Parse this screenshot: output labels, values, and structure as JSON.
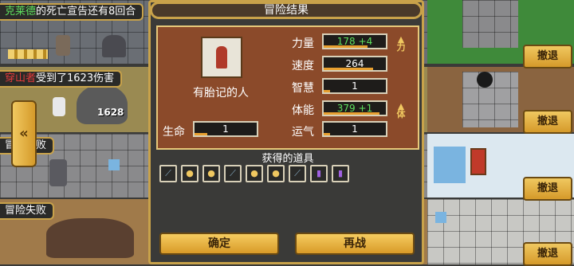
{
  "lanes": [
    {
      "strip_name": "克莱德",
      "strip_text": "的死亡宣告还有8回合",
      "retreat": "撤退"
    },
    {
      "strip_name": "穿山者",
      "strip_text": "受到了1623伤害",
      "damage": "1628",
      "retreat": "撤退"
    },
    {
      "strip_text": "冒险失败",
      "retreat": "撤退"
    },
    {
      "strip_text": "冒险失败",
      "retreat": "撤退"
    }
  ],
  "modal": {
    "title": "冒险结果",
    "character_name": "有胎记的人",
    "hp_label": "生命",
    "hp_value": "1",
    "stats": [
      {
        "label": "力量",
        "value": "178",
        "bonus": "+4",
        "highlight": true,
        "arrow": true,
        "arrow_label": "力"
      },
      {
        "label": "速度",
        "value": "264",
        "bonus": "",
        "highlight": false,
        "arrow": false
      },
      {
        "label": "智慧",
        "value": "1",
        "bonus": "",
        "highlight": false,
        "arrow": false
      },
      {
        "label": "体能",
        "value": "379",
        "bonus": "+1",
        "highlight": true,
        "arrow": true,
        "arrow_label": "体"
      },
      {
        "label": "运气",
        "value": "1",
        "bonus": "",
        "highlight": false,
        "arrow": false
      }
    ],
    "items_title": "获得的道具",
    "items": [
      "sword-icon",
      "gold-icon",
      "gold-icon",
      "sword-icon",
      "gold-icon",
      "gold-icon",
      "sword-icon",
      "potion-icon",
      "potion-icon"
    ],
    "confirm": "确定",
    "again": "再战"
  },
  "colors": {
    "gold": "#c8a24a",
    "panel": "#8b4a2a",
    "green": "#5ee05e",
    "red": "#e23a3a"
  }
}
